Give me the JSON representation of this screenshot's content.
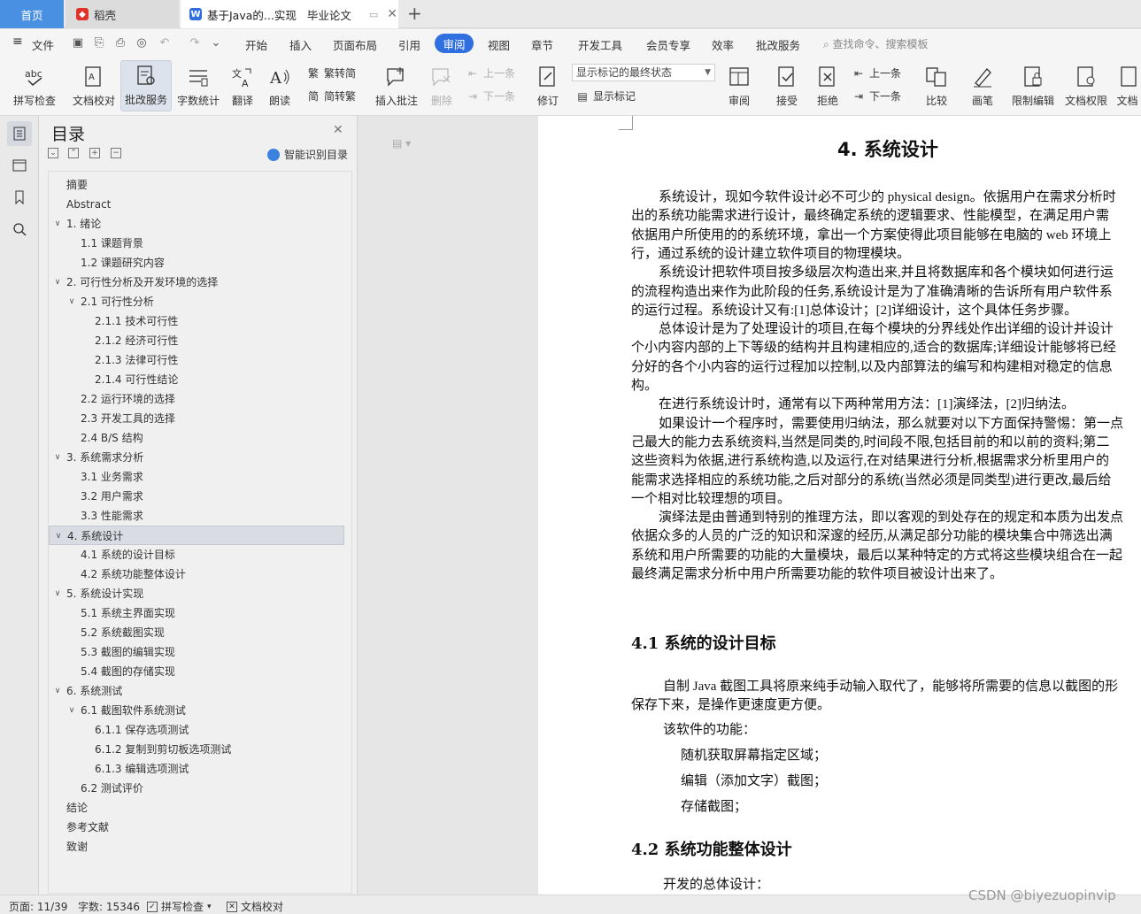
{
  "tabs": {
    "home": "首页",
    "daoke": "稻壳",
    "doc_title": "基于Java的...实现",
    "doc_title_suffix": "毕业论文"
  },
  "menu": {
    "file": "文件",
    "items": [
      "开始",
      "插入",
      "页面布局",
      "引用",
      "审阅",
      "视图",
      "章节",
      "开发工具",
      "会员专享",
      "效率",
      "批改服务"
    ],
    "search": "查找命令、搜索模板"
  },
  "ribbon": {
    "spell_check": "拼写检查",
    "doc_proof": "文档校对",
    "correction_service": "批改服务",
    "word_count": "字数统计",
    "translate": "翻译",
    "read_aloud": "朗读",
    "trad_convert": "繁转简",
    "simp_convert": "简转繁",
    "insert_comment": "插入批注",
    "delete": "删除",
    "prev_item": "上一条",
    "next_item": "下一条",
    "track_changes": "修订",
    "markup_select": "显示标记的最终状态",
    "show_markup": "显示标记",
    "review": "审阅",
    "accept": "接受",
    "reject": "拒绝",
    "prev_change": "上一条",
    "next_change": "下一条",
    "compare": "比较",
    "pen": "画笔",
    "restrict_edit": "限制编辑",
    "doc_permission": "文档权限",
    "doc_more": "文档"
  },
  "toc": {
    "title": "目录",
    "smart": "智能识别目录",
    "items": [
      {
        "text": "摘要",
        "level": 1,
        "arrow": ""
      },
      {
        "text": "Abstract",
        "level": 1,
        "arrow": ""
      },
      {
        "text": "1.  绪论",
        "level": 1,
        "arrow": "v"
      },
      {
        "text": "1.1 课题背景",
        "level": 2,
        "arrow": ""
      },
      {
        "text": "1.2 课题研究内容",
        "level": 2,
        "arrow": ""
      },
      {
        "text": "2.  可行性分析及开发环境的选择",
        "level": 1,
        "arrow": "v"
      },
      {
        "text": "2.1 可行性分析",
        "level": 2,
        "arrow": "v"
      },
      {
        "text": "2.1.1 技术可行性",
        "level": 3,
        "arrow": ""
      },
      {
        "text": "2.1.2 经济可行性",
        "level": 3,
        "arrow": ""
      },
      {
        "text": "2.1.3 法律可行性",
        "level": 3,
        "arrow": ""
      },
      {
        "text": "2.1.4 可行性结论",
        "level": 3,
        "arrow": ""
      },
      {
        "text": "2.2 运行环境的选择",
        "level": 2,
        "arrow": ""
      },
      {
        "text": "2.3 开发工具的选择",
        "level": 2,
        "arrow": ""
      },
      {
        "text": "2.4 B/S 结构",
        "level": 2,
        "arrow": ""
      },
      {
        "text": "3.  系统需求分析",
        "level": 1,
        "arrow": "v"
      },
      {
        "text": "3.1 业务需求",
        "level": 2,
        "arrow": ""
      },
      {
        "text": "3.2 用户需求",
        "level": 2,
        "arrow": ""
      },
      {
        "text": "3.3 性能需求",
        "level": 2,
        "arrow": ""
      },
      {
        "text": "4.  系统设计",
        "level": 1,
        "arrow": "v",
        "selected": true
      },
      {
        "text": "4.1 系统的设计目标",
        "level": 2,
        "arrow": ""
      },
      {
        "text": "4.2 系统功能整体设计",
        "level": 2,
        "arrow": ""
      },
      {
        "text": "5.  系统设计实现",
        "level": 1,
        "arrow": "v"
      },
      {
        "text": "5.1 系统主界面实现",
        "level": 2,
        "arrow": ""
      },
      {
        "text": "5.2 系统截图实现",
        "level": 2,
        "arrow": ""
      },
      {
        "text": "5.3 截图的编辑实现",
        "level": 2,
        "arrow": ""
      },
      {
        "text": "5.4 截图的存储实现",
        "level": 2,
        "arrow": ""
      },
      {
        "text": "6.  系统测试",
        "level": 1,
        "arrow": "v"
      },
      {
        "text": "6.1 截图软件系统测试",
        "level": 2,
        "arrow": "v"
      },
      {
        "text": "6.1.1 保存选项测试",
        "level": 3,
        "arrow": ""
      },
      {
        "text": "6.1.2 复制到剪切板选项测试",
        "level": 3,
        "arrow": ""
      },
      {
        "text": "6.1.3 编辑选项测试",
        "level": 3,
        "arrow": ""
      },
      {
        "text": "6.2 测试评价",
        "level": 2,
        "arrow": ""
      },
      {
        "text": "结论",
        "level": 1,
        "arrow": ""
      },
      {
        "text": "参考文献",
        "level": 1,
        "arrow": ""
      },
      {
        "text": "致谢",
        "level": 1,
        "arrow": ""
      }
    ]
  },
  "document": {
    "heading": "4.  系统设计",
    "lines": [
      "系统设计，现如今软件设计必不可少的 physical design。依据用户在需求分析时",
      "出的系统功能需求进行设计，最终确定系统的逻辑要求、性能模型，在满足用户需",
      "依据用户所使用的的系统环境，拿出一个方案使得此项目能够在电脑的 web 环境上",
      "行，通过系统的设计建立软件项目的物理模块。",
      "系统设计把软件项目按多级层次构造出来,并且将数据库和各个模块如何进行运",
      "的流程构造出来作为此阶段的任务,系统设计是为了准确清晰的告诉所有用户软件系",
      "的运行过程。系统设计又有:[1]总体设计；[2]详细设计，这个具体任务步骤。",
      "总体设计是为了处理设计的项目,在每个模块的分界线处作出详细的设计并设计",
      "个小内容内部的上下等级的结构并且构建相应的,适合的数据库;详细设计能够将已经",
      "分好的各个小内容的运行过程加以控制,以及内部算法的编写和构建相对稳定的信息",
      "构。",
      "在进行系统设计时，通常有以下两种常用方法：[1]演绎法，[2]归纳法。",
      "如果设计一个程序时，需要使用归纳法，那么就要对以下方面保持警惕：第一点",
      "己最大的能力去系统资料,当然是同类的,时间段不限,包括目前的和以前的资料;第二",
      "这些资料为依据,进行系统构造,以及运行,在对结果进行分析,根据需求分析里用户的",
      "能需求选择相应的系统功能,之后对部分的系统(当然必须是同类型)进行更改,最后给",
      "一个相对比较理想的项目。",
      "演绎法是由普通到特别的推理方法，即以客观的到处存在的规定和本质为出发点",
      "依据众多的人员的广泛的知识和深邃的经历,从满足部分功能的模块集合中筛选出满",
      "系统和用户所需要的功能的大量模块，最后以某种特定的方式将这些模块组合在一起",
      "最终满足需求分析中用户所需要功能的软件项目被设计出来了。"
    ],
    "h2_1": "4.1 系统的设计目标",
    "lines2": [
      "自制 Java 截图工具将原来纯手动输入取代了，能够将所需要的信息以截图的形",
      "保存下来，是操作更速度更方便。",
      "该软件的功能：",
      "随机获取屏幕指定区域；",
      "编辑（添加文字）截图；",
      "存储截图；"
    ],
    "h2_2": "4.2 系统功能整体设计",
    "lines3": [
      "开发的总体设计："
    ]
  },
  "status": {
    "page": "页面: 11/39",
    "words": "字数: 15346",
    "spell": "拼写检查",
    "proof": "文档校对"
  },
  "watermark": "CSDN @biyezuopinvip",
  "colors": {
    "accent": "#2f6fe0",
    "home_tab": "#4a90e2",
    "daoke_red": "#e0312b"
  }
}
